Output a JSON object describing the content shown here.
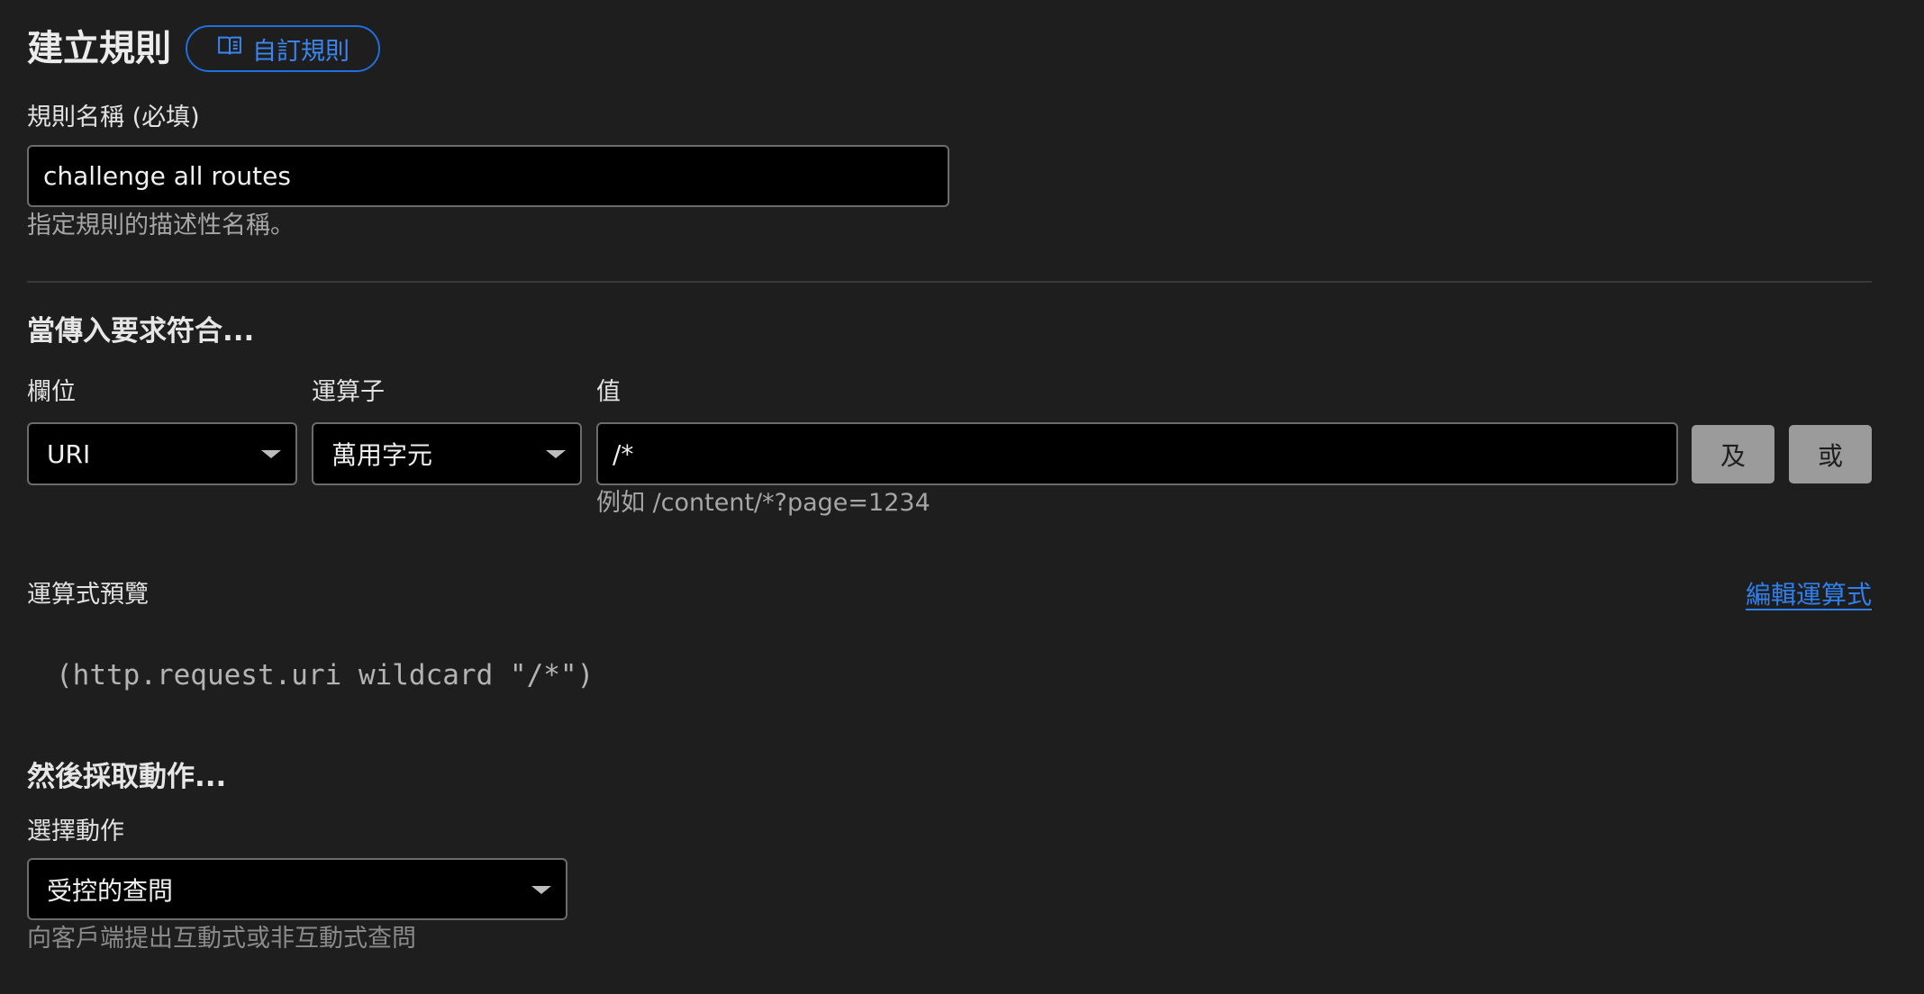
{
  "header": {
    "title": "建立規則",
    "custom_rules_link": "自訂規則",
    "custom_rules_icon": "book-icon"
  },
  "rule_name": {
    "label": "規則名稱 (必填)",
    "value": "challenge all routes",
    "helper": "指定規則的描述性名稱。"
  },
  "match_section": {
    "heading": "當傳入要求符合...",
    "field": {
      "label": "欄位",
      "value": "URI"
    },
    "operator": {
      "label": "運算子",
      "value": "萬用字元"
    },
    "value": {
      "label": "值",
      "value": "/*",
      "helper": "例如 /content/*?page=1234"
    },
    "and_button": "及",
    "or_button": "或"
  },
  "expression": {
    "label": "運算式預覽",
    "edit_link": "編輯運算式",
    "preview": "(http.request.uri wildcard \"/*\")"
  },
  "action_section": {
    "heading": "然後採取動作...",
    "label": "選擇動作",
    "value": "受控的查問",
    "helper": "向客戶端提出互動式或非互動式查問"
  },
  "colors": {
    "background": "#1e1e1e",
    "input_background": "#000000",
    "accent": "#2f80ed",
    "button_gray": "#9b9b9b"
  }
}
